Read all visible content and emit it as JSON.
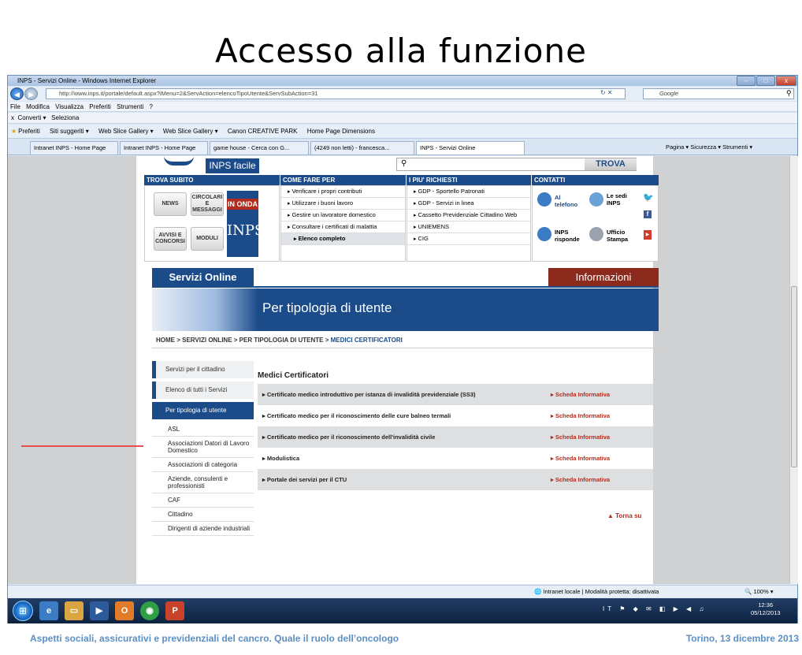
{
  "slide": {
    "title": "Accesso alla funzione",
    "footer_left": "Aspetti sociali, assicurativi e previdenziali del cancro. Quale il ruolo dell’oncologo",
    "footer_right": "Torino, 13 dicembre 2013"
  },
  "window": {
    "title": "INPS - Servizi Online - Windows Internet Explorer",
    "url": "http://www.inps.it/portale/default.aspx?iMenu=2&ServAction=elencoTipoUtente&ServSubAction=31",
    "search_engine": "Google"
  },
  "menubar": [
    "File",
    "Modifica",
    "Visualizza",
    "Preferiti",
    "Strumenti",
    "?"
  ],
  "toolbar2": {
    "close": "x",
    "converti": "Converti",
    "seleziona": "Seleziona"
  },
  "favorites": {
    "label": "Preferiti",
    "items": [
      "Siti suggeriti ▾",
      "Web Slice Gallery ▾",
      "Web Slice Gallery ▾",
      "Canon CREATIVE PARK",
      "Home Page Dimensions"
    ]
  },
  "tabs": [
    "Intranet INPS - Home Page",
    "Intranet INPS - Home Page",
    "game house - Cerca con G...",
    "(4249 non letti) - francesca...",
    "INPS - Servizi Online"
  ],
  "commandbar": "Pagina ▾  Sicurezza ▾  Strumenti ▾",
  "inps": {
    "inps_facile": "INPS facile",
    "trova": "TROVA",
    "sections": {
      "trova_subito": "TROVA SUBITO",
      "come_fare_per": "COME FARE PER",
      "piu_richiesti": "I PIU' RICHIESTI",
      "contatti": "CONTATTI"
    },
    "quick_buttons": [
      "NEWS",
      "CIRCOLARI E MESSAGGI",
      "AVVISI E CONCORSI",
      "MODULI"
    ],
    "in_onda": "IN ONDA",
    "come_fare": [
      "Verificare i propri contributi",
      "Utilizzare i buoni lavoro",
      "Gestire un lavoratore domestico",
      "Consultare i certificati di malattia"
    ],
    "elenco_completo": "Elenco completo",
    "richiesti": [
      "GDP - Sportello Patronati",
      "GDP - Servizi in linea",
      "Cassetto Previdenziale Cittadino Web",
      "UNIEMENS",
      "CIG"
    ],
    "contatti": {
      "telefono": "Al telefono",
      "sedi": "Le sedi INPS",
      "risponde": "INPS risponde",
      "stampa": "Ufficio Stampa"
    },
    "servizi_online": "Servizi Online",
    "informazioni": "Informazioni",
    "banner_title": "Per tipologia di utente",
    "breadcrumb": {
      "path": "HOME > SERVIZI ONLINE > PER TIPOLOGIA DI UTENTE > ",
      "current": "MEDICI CERTIFICATORI"
    },
    "sidebar": [
      "Servizi per il cittadino",
      "Elenco di tutti i Servizi",
      "Per tipologia di utente"
    ],
    "sub_items": [
      "ASL",
      "Associazioni Datori di Lavoro Domestico",
      "Associazioni di categoria",
      "Aziende, consulenti e professionisti",
      "CAF",
      "Cittadino",
      "Dirigenti di aziende industriali"
    ],
    "heading": "Medici Certificatori",
    "rows": [
      {
        "label": "Certificato medico introduttivo per istanza di invalidità previdenziale (SS3)",
        "link": "Scheda Informativa"
      },
      {
        "label": "Certificato medico per il riconoscimento delle cure balneo termali",
        "link": "Scheda Informativa"
      },
      {
        "label": "Certificato medico per il riconoscimento dell'invalidità civile",
        "link": "Scheda Informativa"
      },
      {
        "label": "Modulistica",
        "link": "Scheda Informativa"
      },
      {
        "label": "Portale dei servizi per il CTU",
        "link": "Scheda Informativa"
      }
    ],
    "torna_su": "Torna su"
  },
  "statusbar": {
    "zone": "Intranet locale | Modalità protetta: disattivata",
    "zoom": "100%"
  },
  "taskbar": {
    "lang": "IT",
    "time": "12:36",
    "date": "05/12/2013"
  }
}
